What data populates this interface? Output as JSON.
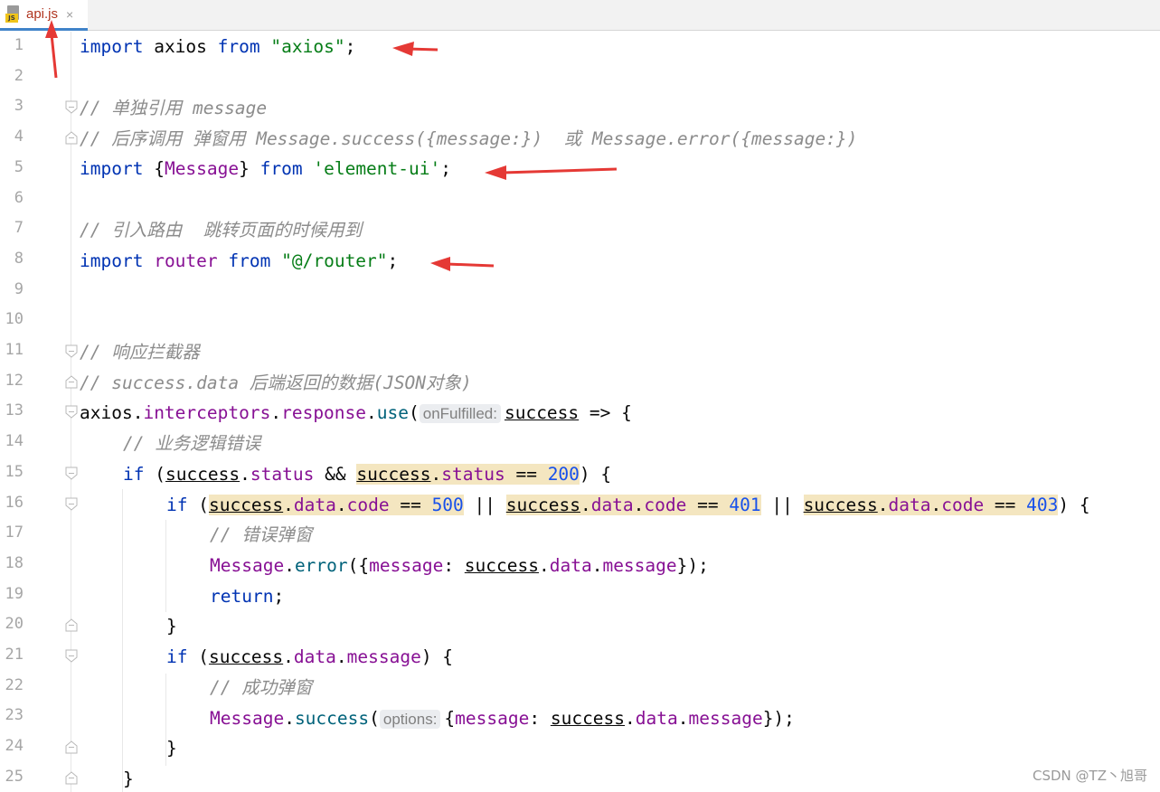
{
  "tab": {
    "filename": "api.js",
    "close": "×",
    "icon": "js-file-icon",
    "badge": "JS"
  },
  "watermark": "CSDN @TZ丶旭哥",
  "line_numbers": [
    "1",
    "2",
    "3",
    "4",
    "5",
    "6",
    "7",
    "8",
    "9",
    "10",
    "11",
    "12",
    "13",
    "14",
    "15",
    "16",
    "17",
    "18",
    "19",
    "20",
    "21",
    "22",
    "23",
    "24",
    "25"
  ],
  "code": {
    "l1": {
      "kw": "import",
      "id": "axios",
      "from": "from",
      "str": "\"axios\"",
      "end": ";"
    },
    "l3": "// 单独引用 message",
    "l4": "// 后序调用 弹窗用 Message.success({message:})  或 Message.error({message:})",
    "l5": {
      "kw": "import",
      "open": "{",
      "id": "Message",
      "close": "}",
      "from": "from",
      "str": "'element-ui'",
      "end": ";"
    },
    "l7": "// 引入路由  跳转页面的时候用到",
    "l8": {
      "kw": "import",
      "id": "router",
      "from": "from",
      "str": "\"@/router\"",
      "end": ";"
    },
    "l11": "// 响应拦截器",
    "l12": "// success.data 后端返回的数据(JSON对象)",
    "l13": {
      "obj": "axios",
      "dot1": ".",
      "p1": "interceptors",
      "dot2": ".",
      "p2": "response",
      "dot3": ".",
      "fn": "use",
      "open": "(",
      "hint": "onFulfilled:",
      "param": "success",
      "arrow": " => {"
    },
    "l14": "// 业务逻辑错误",
    "l15": {
      "kw": "if",
      "open": " (",
      "param1": "success",
      "dot1": ".",
      "p1": "status",
      "and": " && ",
      "param2": "success",
      "dot2": ".",
      "p2": "status",
      "eq": " == ",
      "num": "200",
      "close": ") {"
    },
    "l16": {
      "kw": "if",
      "open": " (",
      "param": "success",
      "dot": ".",
      "data": "data",
      "code": "code",
      "eq": " == ",
      "n1": "500",
      "n2": "401",
      "n3": "403",
      "or": " || ",
      "close": ") {"
    },
    "l17": "// 错误弹窗",
    "l18": {
      "cls": "Message",
      "dot": ".",
      "fn": "error",
      "open": "({",
      "key": "message",
      "colon": ": ",
      "param": "success",
      "data": "data",
      "msg": "message",
      "close": "});"
    },
    "l19": {
      "kw": "return",
      "end": ";"
    },
    "l20": "}",
    "l21": {
      "kw": "if",
      "open": " (",
      "param": "success",
      "dot": ".",
      "data": "data",
      "msg": "message",
      "close": ") {"
    },
    "l22": "// 成功弹窗",
    "l23": {
      "cls": "Message",
      "dot": ".",
      "fn": "success",
      "open": "(",
      "hint": "options:",
      "brace": "{",
      "key": "message",
      "colon": ": ",
      "param": "success",
      "data": "data",
      "msg": "message",
      "close": "});"
    },
    "l24": "}",
    "l25": "}"
  },
  "colors": {
    "keyword": "#0033b3",
    "string": "#067d17",
    "comment": "#8c8c8c",
    "function": "#00627a",
    "property": "#871094",
    "number": "#1750eb",
    "highlight": "#f4e6c0",
    "arrow": "#e53935"
  }
}
